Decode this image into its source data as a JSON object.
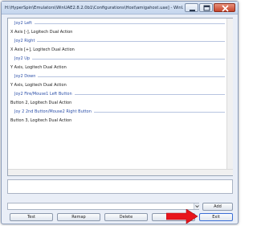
{
  "window": {
    "title": "H:\\HyperSpin\\Emulators\\WinUAE2.8.2.0b1\\Configurations\\Host\\amigahost.uae] - WinUAE Propert..."
  },
  "list": {
    "rows": [
      {
        "kind": "group",
        "text": "Joy2 Left"
      },
      {
        "kind": "item",
        "text": "X Axis [-], Logitech Dual Action"
      },
      {
        "kind": "group",
        "text": "Joy2 Right"
      },
      {
        "kind": "item",
        "text": "X Axis [+], Logitech Dual Action"
      },
      {
        "kind": "group",
        "text": "Joy2 Up"
      },
      {
        "kind": "item",
        "text": "Y Axis, Logitech Dual Action"
      },
      {
        "kind": "group",
        "text": "Joy2 Down"
      },
      {
        "kind": "item",
        "text": "Y Axis, Logitech Dual Action"
      },
      {
        "kind": "group",
        "text": "Joy2 Fire/Mouse1 Left Button"
      },
      {
        "kind": "item",
        "text": "Button 2, Logitech Dual Action"
      },
      {
        "kind": "group",
        "text": "Joy 2 2nd Button/Mouse2 Right Button"
      },
      {
        "kind": "item",
        "text": "Button 3, Logitech Dual Action"
      }
    ]
  },
  "buttons": {
    "add": "Add",
    "test": "Test",
    "remap": "Remap",
    "delete": "Delete",
    "delete_all": "Delete",
    "exit": "Exit"
  },
  "icons": {
    "arrow": "red-arrow-icon",
    "combo_arrow": "chevron-down-icon"
  },
  "colors": {
    "group_text": "#2b4fa8",
    "arrow": "#e8141c",
    "close": "#c6452c"
  }
}
